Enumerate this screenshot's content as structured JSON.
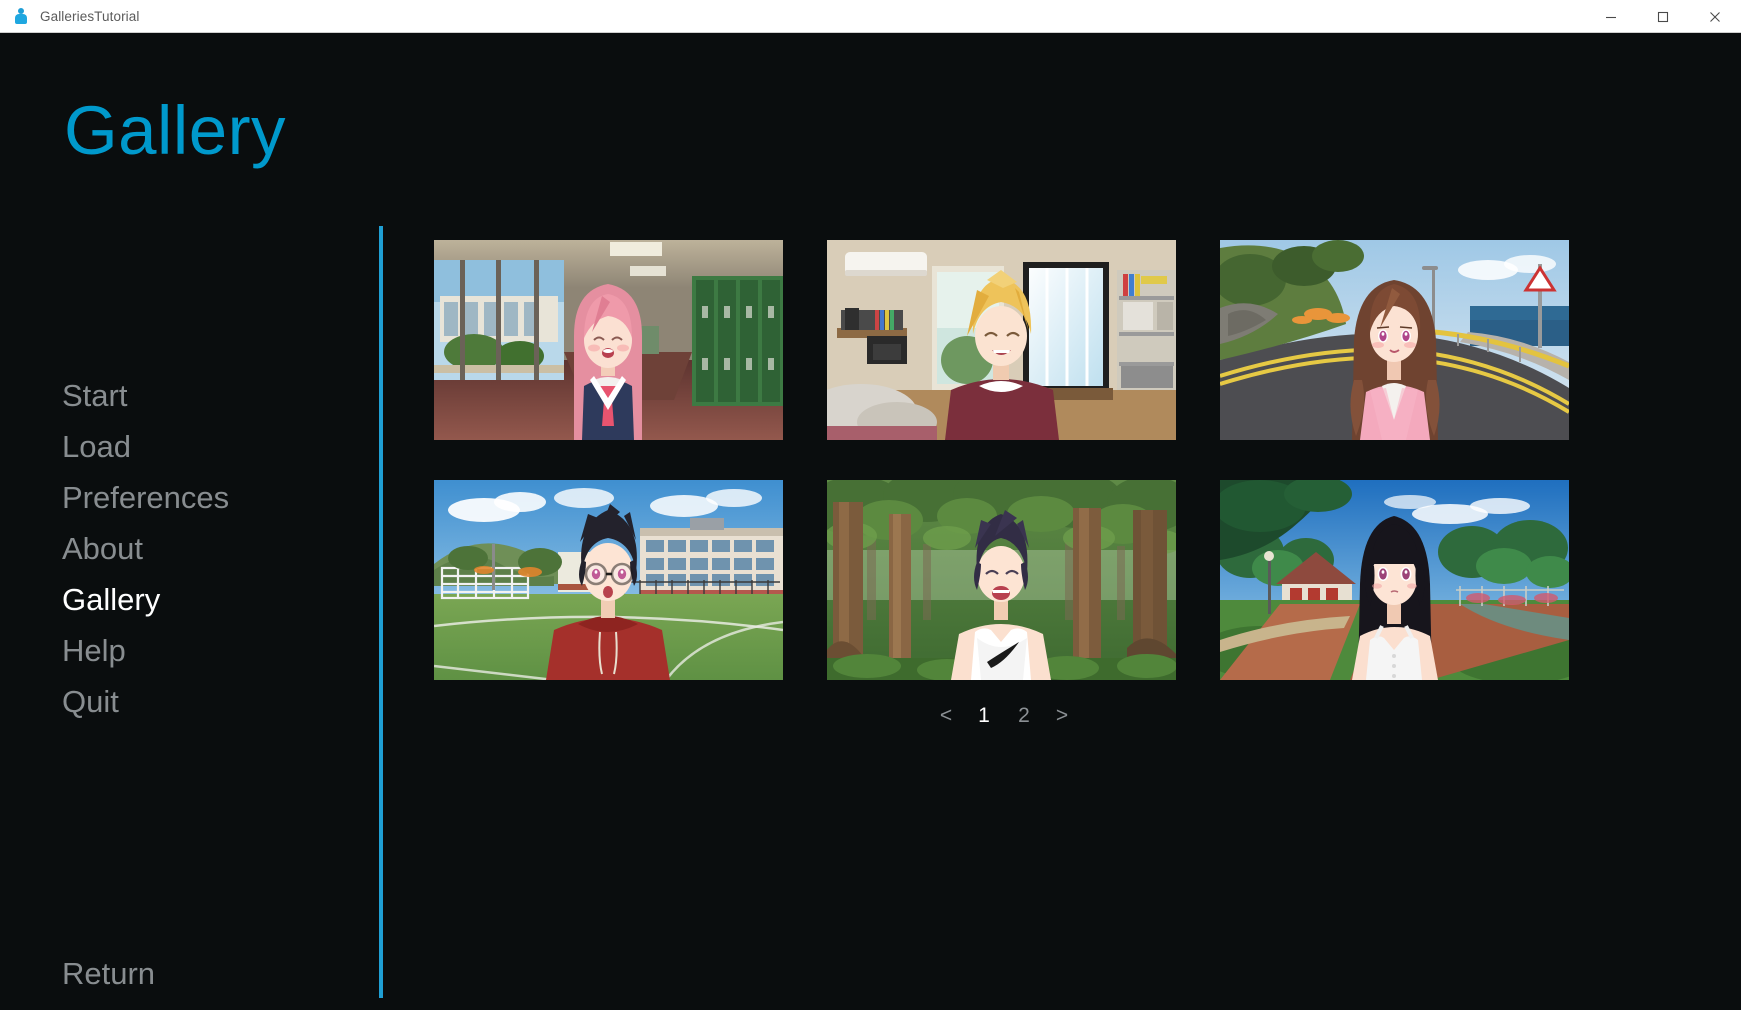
{
  "window": {
    "title": "GalleriesTutorial",
    "icon": "renpy-app-icon",
    "controls": {
      "minimize": "minimize-icon",
      "maximize": "maximize-icon",
      "close": "close-icon"
    }
  },
  "screen": {
    "title": "Gallery",
    "accent_color": "#0099cc",
    "background_color": "#0a0d0e",
    "divider_color": "#1f9fd4",
    "inactive_text_color": "#888d90",
    "active_text_color": "#ffffff"
  },
  "nav": {
    "items": [
      {
        "label": "Start",
        "active": false
      },
      {
        "label": "Load",
        "active": false
      },
      {
        "label": "Preferences",
        "active": false
      },
      {
        "label": "About",
        "active": false
      },
      {
        "label": "Gallery",
        "active": true
      },
      {
        "label": "Help",
        "active": false
      },
      {
        "label": "Quit",
        "active": false
      }
    ],
    "return_label": "Return"
  },
  "gallery": {
    "items": [
      {
        "id": "thumb-1",
        "description": "Pink-haired schoolgirl in sailor uniform smiling in a school hallway with green lockers"
      },
      {
        "id": "thumb-2",
        "description": "Blond boy in maroon sweater smiling in a bedroom with bookshelf and balcony door"
      },
      {
        "id": "thumb-3",
        "description": "Brown-haired girl in pink cardigan on a seaside coastal road"
      },
      {
        "id": "thumb-4",
        "description": "Dark-haired boy with glasses in red hoodie on a school sports field"
      },
      {
        "id": "thumb-5",
        "description": "Dark-haired character in white tank top laughing in a forest"
      },
      {
        "id": "thumb-6",
        "description": "Black bob-haired girl in white camisole on a park path"
      }
    ]
  },
  "pagination": {
    "prev_label": "<",
    "next_label": ">",
    "pages": [
      {
        "label": "1",
        "active": true
      },
      {
        "label": "2",
        "active": false
      }
    ]
  }
}
